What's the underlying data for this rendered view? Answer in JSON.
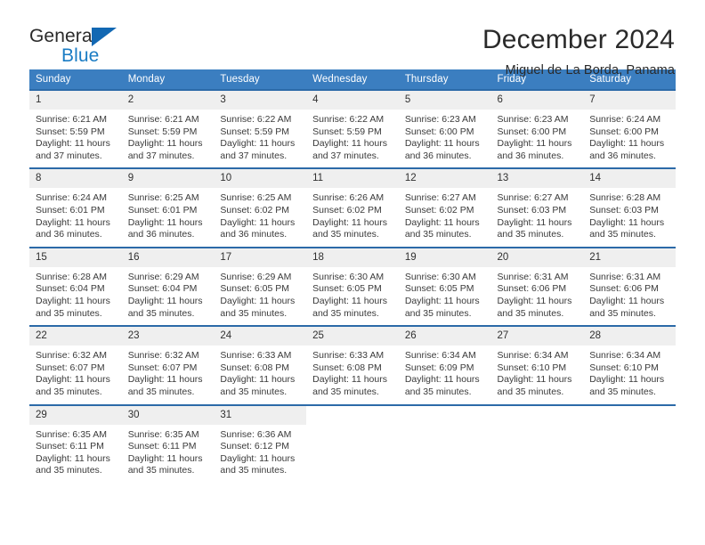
{
  "logo": {
    "word_one": "General",
    "word_two": "Blue",
    "triangle_color": "#1268b3",
    "blue_color": "#1a7cc4"
  },
  "header": {
    "month_title": "December 2024",
    "location": "Miguel de La Borda, Panama"
  },
  "theme": {
    "header_row_bg": "#3b7ec0",
    "row_top_border": "#2c6aa8",
    "daynum_bg": "#efefef",
    "text": "#3a3a3a"
  },
  "weekday_headers": [
    "Sunday",
    "Monday",
    "Tuesday",
    "Wednesday",
    "Thursday",
    "Friday",
    "Saturday"
  ],
  "weeks": [
    [
      {
        "day": "1",
        "sunrise": "Sunrise: 6:21 AM",
        "sunset": "Sunset: 5:59 PM",
        "daylight_line1": "Daylight: 11 hours",
        "daylight_line2": "and 37 minutes."
      },
      {
        "day": "2",
        "sunrise": "Sunrise: 6:21 AM",
        "sunset": "Sunset: 5:59 PM",
        "daylight_line1": "Daylight: 11 hours",
        "daylight_line2": "and 37 minutes."
      },
      {
        "day": "3",
        "sunrise": "Sunrise: 6:22 AM",
        "sunset": "Sunset: 5:59 PM",
        "daylight_line1": "Daylight: 11 hours",
        "daylight_line2": "and 37 minutes."
      },
      {
        "day": "4",
        "sunrise": "Sunrise: 6:22 AM",
        "sunset": "Sunset: 5:59 PM",
        "daylight_line1": "Daylight: 11 hours",
        "daylight_line2": "and 37 minutes."
      },
      {
        "day": "5",
        "sunrise": "Sunrise: 6:23 AM",
        "sunset": "Sunset: 6:00 PM",
        "daylight_line1": "Daylight: 11 hours",
        "daylight_line2": "and 36 minutes."
      },
      {
        "day": "6",
        "sunrise": "Sunrise: 6:23 AM",
        "sunset": "Sunset: 6:00 PM",
        "daylight_line1": "Daylight: 11 hours",
        "daylight_line2": "and 36 minutes."
      },
      {
        "day": "7",
        "sunrise": "Sunrise: 6:24 AM",
        "sunset": "Sunset: 6:00 PM",
        "daylight_line1": "Daylight: 11 hours",
        "daylight_line2": "and 36 minutes."
      }
    ],
    [
      {
        "day": "8",
        "sunrise": "Sunrise: 6:24 AM",
        "sunset": "Sunset: 6:01 PM",
        "daylight_line1": "Daylight: 11 hours",
        "daylight_line2": "and 36 minutes."
      },
      {
        "day": "9",
        "sunrise": "Sunrise: 6:25 AM",
        "sunset": "Sunset: 6:01 PM",
        "daylight_line1": "Daylight: 11 hours",
        "daylight_line2": "and 36 minutes."
      },
      {
        "day": "10",
        "sunrise": "Sunrise: 6:25 AM",
        "sunset": "Sunset: 6:02 PM",
        "daylight_line1": "Daylight: 11 hours",
        "daylight_line2": "and 36 minutes."
      },
      {
        "day": "11",
        "sunrise": "Sunrise: 6:26 AM",
        "sunset": "Sunset: 6:02 PM",
        "daylight_line1": "Daylight: 11 hours",
        "daylight_line2": "and 35 minutes."
      },
      {
        "day": "12",
        "sunrise": "Sunrise: 6:27 AM",
        "sunset": "Sunset: 6:02 PM",
        "daylight_line1": "Daylight: 11 hours",
        "daylight_line2": "and 35 minutes."
      },
      {
        "day": "13",
        "sunrise": "Sunrise: 6:27 AM",
        "sunset": "Sunset: 6:03 PM",
        "daylight_line1": "Daylight: 11 hours",
        "daylight_line2": "and 35 minutes."
      },
      {
        "day": "14",
        "sunrise": "Sunrise: 6:28 AM",
        "sunset": "Sunset: 6:03 PM",
        "daylight_line1": "Daylight: 11 hours",
        "daylight_line2": "and 35 minutes."
      }
    ],
    [
      {
        "day": "15",
        "sunrise": "Sunrise: 6:28 AM",
        "sunset": "Sunset: 6:04 PM",
        "daylight_line1": "Daylight: 11 hours",
        "daylight_line2": "and 35 minutes."
      },
      {
        "day": "16",
        "sunrise": "Sunrise: 6:29 AM",
        "sunset": "Sunset: 6:04 PM",
        "daylight_line1": "Daylight: 11 hours",
        "daylight_line2": "and 35 minutes."
      },
      {
        "day": "17",
        "sunrise": "Sunrise: 6:29 AM",
        "sunset": "Sunset: 6:05 PM",
        "daylight_line1": "Daylight: 11 hours",
        "daylight_line2": "and 35 minutes."
      },
      {
        "day": "18",
        "sunrise": "Sunrise: 6:30 AM",
        "sunset": "Sunset: 6:05 PM",
        "daylight_line1": "Daylight: 11 hours",
        "daylight_line2": "and 35 minutes."
      },
      {
        "day": "19",
        "sunrise": "Sunrise: 6:30 AM",
        "sunset": "Sunset: 6:05 PM",
        "daylight_line1": "Daylight: 11 hours",
        "daylight_line2": "and 35 minutes."
      },
      {
        "day": "20",
        "sunrise": "Sunrise: 6:31 AM",
        "sunset": "Sunset: 6:06 PM",
        "daylight_line1": "Daylight: 11 hours",
        "daylight_line2": "and 35 minutes."
      },
      {
        "day": "21",
        "sunrise": "Sunrise: 6:31 AM",
        "sunset": "Sunset: 6:06 PM",
        "daylight_line1": "Daylight: 11 hours",
        "daylight_line2": "and 35 minutes."
      }
    ],
    [
      {
        "day": "22",
        "sunrise": "Sunrise: 6:32 AM",
        "sunset": "Sunset: 6:07 PM",
        "daylight_line1": "Daylight: 11 hours",
        "daylight_line2": "and 35 minutes."
      },
      {
        "day": "23",
        "sunrise": "Sunrise: 6:32 AM",
        "sunset": "Sunset: 6:07 PM",
        "daylight_line1": "Daylight: 11 hours",
        "daylight_line2": "and 35 minutes."
      },
      {
        "day": "24",
        "sunrise": "Sunrise: 6:33 AM",
        "sunset": "Sunset: 6:08 PM",
        "daylight_line1": "Daylight: 11 hours",
        "daylight_line2": "and 35 minutes."
      },
      {
        "day": "25",
        "sunrise": "Sunrise: 6:33 AM",
        "sunset": "Sunset: 6:08 PM",
        "daylight_line1": "Daylight: 11 hours",
        "daylight_line2": "and 35 minutes."
      },
      {
        "day": "26",
        "sunrise": "Sunrise: 6:34 AM",
        "sunset": "Sunset: 6:09 PM",
        "daylight_line1": "Daylight: 11 hours",
        "daylight_line2": "and 35 minutes."
      },
      {
        "day": "27",
        "sunrise": "Sunrise: 6:34 AM",
        "sunset": "Sunset: 6:10 PM",
        "daylight_line1": "Daylight: 11 hours",
        "daylight_line2": "and 35 minutes."
      },
      {
        "day": "28",
        "sunrise": "Sunrise: 6:34 AM",
        "sunset": "Sunset: 6:10 PM",
        "daylight_line1": "Daylight: 11 hours",
        "daylight_line2": "and 35 minutes."
      }
    ],
    [
      {
        "day": "29",
        "sunrise": "Sunrise: 6:35 AM",
        "sunset": "Sunset: 6:11 PM",
        "daylight_line1": "Daylight: 11 hours",
        "daylight_line2": "and 35 minutes."
      },
      {
        "day": "30",
        "sunrise": "Sunrise: 6:35 AM",
        "sunset": "Sunset: 6:11 PM",
        "daylight_line1": "Daylight: 11 hours",
        "daylight_line2": "and 35 minutes."
      },
      {
        "day": "31",
        "sunrise": "Sunrise: 6:36 AM",
        "sunset": "Sunset: 6:12 PM",
        "daylight_line1": "Daylight: 11 hours",
        "daylight_line2": "and 35 minutes."
      },
      {
        "day": "",
        "sunrise": "",
        "sunset": "",
        "daylight_line1": "",
        "daylight_line2": ""
      },
      {
        "day": "",
        "sunrise": "",
        "sunset": "",
        "daylight_line1": "",
        "daylight_line2": ""
      },
      {
        "day": "",
        "sunrise": "",
        "sunset": "",
        "daylight_line1": "",
        "daylight_line2": ""
      },
      {
        "day": "",
        "sunrise": "",
        "sunset": "",
        "daylight_line1": "",
        "daylight_line2": ""
      }
    ]
  ]
}
